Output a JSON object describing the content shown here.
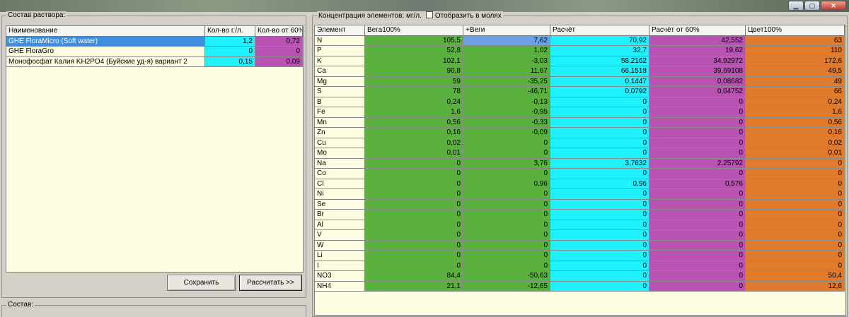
{
  "window": {
    "minimize": "▁",
    "maximize": "▢",
    "close": "✕"
  },
  "solution": {
    "title": "Состав раствора:",
    "columns": [
      "Наименование",
      "Кол-во г./л.",
      "Кол-во от 60%"
    ],
    "rows": [
      {
        "name": "GHE FloraMicro (Soft water)",
        "qty": "1,2",
        "qty60": "0,72",
        "selected": true
      },
      {
        "name": "GHE FloraGro",
        "qty": "0",
        "qty60": "0",
        "selected": false
      },
      {
        "name": "Монофосфат Калия KH2PO4 (Буйские уд-я) вариант 2",
        "qty": "0,15",
        "qty60": "0,09",
        "selected": false
      }
    ],
    "save_label": "Сохранить",
    "calc_label": "Рассчитать >>"
  },
  "composition": {
    "title": "Состав:"
  },
  "concentration": {
    "title": "Концентрация элементов: мг/л.",
    "moles_label": "Отобразить в молях",
    "columns": [
      "Элемент",
      "Вега100%",
      "+Веги",
      "Расчёт",
      "Расчёт от 60%",
      "Цвет100%"
    ],
    "rows": [
      [
        "N",
        "105,5",
        "7,62",
        "70,92",
        "42,552",
        "63"
      ],
      [
        "P",
        "52,8",
        "1,02",
        "32,7",
        "19,62",
        "110"
      ],
      [
        "K",
        "102,1",
        "-3,03",
        "58,2162",
        "34,92972",
        "172,6"
      ],
      [
        "Ca",
        "90,8",
        "11,67",
        "66,1518",
        "39,69108",
        "49,5"
      ],
      [
        "Mg",
        "59",
        "-35,25",
        "0,1447",
        "0,08682",
        "49"
      ],
      [
        "S",
        "78",
        "-46,71",
        "0,0792",
        "0,04752",
        "66"
      ],
      [
        "B",
        "0,24",
        "-0,13",
        "0",
        "0",
        "0,24"
      ],
      [
        "Fe",
        "1,6",
        "-0,95",
        "0",
        "0",
        "1,6"
      ],
      [
        "Mn",
        "0,56",
        "-0,33",
        "0",
        "0",
        "0,56"
      ],
      [
        "Zn",
        "0,16",
        "-0,09",
        "0",
        "0",
        "0,16"
      ],
      [
        "Cu",
        "0,02",
        "0",
        "0",
        "0",
        "0,02"
      ],
      [
        "Mo",
        "0,01",
        "0",
        "0",
        "0",
        "0,01"
      ],
      [
        "Na",
        "0",
        "3,76",
        "3,7632",
        "2,25792",
        "0"
      ],
      [
        "Co",
        "0",
        "0",
        "0",
        "0",
        "0"
      ],
      [
        "Cl",
        "0",
        "0,96",
        "0,96",
        "0,576",
        "0"
      ],
      [
        "Ni",
        "0",
        "0",
        "0",
        "0",
        "0"
      ],
      [
        "Se",
        "0",
        "0",
        "0",
        "0",
        "0"
      ],
      [
        "Br",
        "0",
        "0",
        "0",
        "0",
        "0"
      ],
      [
        "Al",
        "0",
        "0",
        "0",
        "0",
        "0"
      ],
      [
        "V",
        "0",
        "0",
        "0",
        "0",
        "0"
      ],
      [
        "W",
        "0",
        "0",
        "0",
        "0",
        "0"
      ],
      [
        "Li",
        "0",
        "0",
        "0",
        "0",
        "0"
      ],
      [
        "I",
        "0",
        "0",
        "0",
        "0",
        "0"
      ],
      [
        "NO3",
        "84,4",
        "-50,63",
        "0",
        "0",
        "50,4"
      ],
      [
        "NH4",
        "21,1",
        "-12,65",
        "0",
        "0",
        "12,6"
      ]
    ]
  },
  "colors": {
    "green": "#5bb13d",
    "cyan": "#1ff1ff",
    "magenta": "#b953b3",
    "orange": "#e07a2c",
    "selected": "#3b8ee0",
    "grid_bg": "#fffde1"
  }
}
